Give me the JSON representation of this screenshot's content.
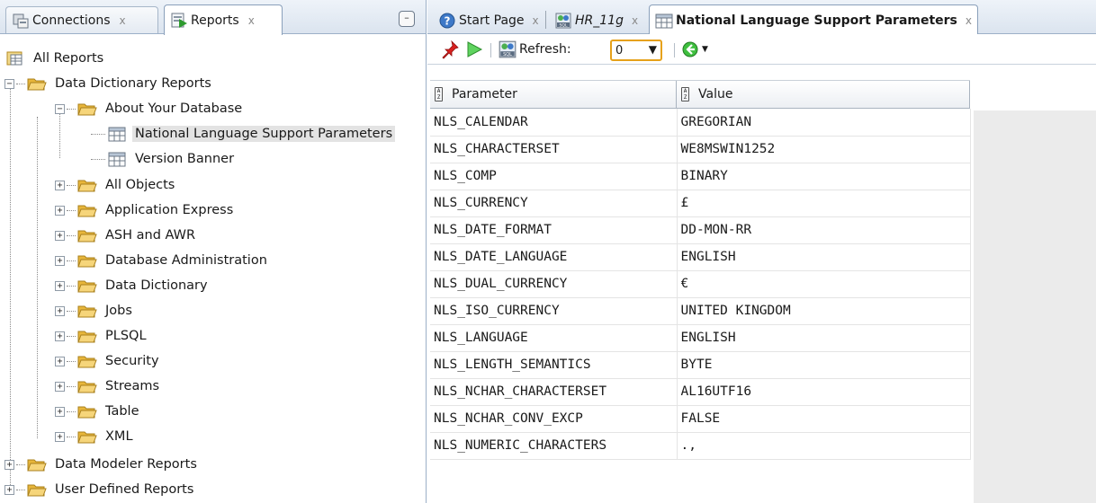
{
  "left_panel": {
    "tabs": [
      {
        "label": "Connections",
        "close": "x"
      },
      {
        "label": "Reports",
        "close": "x"
      }
    ],
    "minimize_label": "–",
    "tree": {
      "root": "All Reports",
      "data_dictionary_reports": "Data Dictionary Reports",
      "about_your_database": "About Your Database",
      "nls_parameters": "National Language Support Parameters",
      "version_banner": "Version Banner",
      "children": [
        "All Objects",
        "Application Express",
        "ASH and AWR",
        "Database Administration",
        "Data Dictionary",
        "Jobs",
        "PLSQL",
        "Security",
        "Streams",
        "Table",
        "XML"
      ],
      "data_modeler_reports": "Data Modeler Reports",
      "user_defined_reports": "User Defined Reports"
    }
  },
  "editor": {
    "tabs": [
      {
        "label": "Start Page",
        "close": "x"
      },
      {
        "label": "HR_11g",
        "close": "x"
      },
      {
        "label": "National Language Support Parameters",
        "close": "x"
      }
    ],
    "toolbar": {
      "refresh_label": "Refresh:",
      "refresh_value": "0"
    },
    "grid": {
      "columns": [
        "Parameter",
        "Value"
      ],
      "rows": [
        [
          "NLS_CALENDAR",
          "GREGORIAN"
        ],
        [
          "NLS_CHARACTERSET",
          "WE8MSWIN1252"
        ],
        [
          "NLS_COMP",
          "BINARY"
        ],
        [
          "NLS_CURRENCY",
          "£"
        ],
        [
          "NLS_DATE_FORMAT",
          "DD-MON-RR"
        ],
        [
          "NLS_DATE_LANGUAGE",
          "ENGLISH"
        ],
        [
          "NLS_DUAL_CURRENCY",
          "€"
        ],
        [
          "NLS_ISO_CURRENCY",
          "UNITED KINGDOM"
        ],
        [
          "NLS_LANGUAGE",
          "ENGLISH"
        ],
        [
          "NLS_LENGTH_SEMANTICS",
          "BYTE"
        ],
        [
          "NLS_NCHAR_CHARACTERSET",
          "AL16UTF16"
        ],
        [
          "NLS_NCHAR_CONV_EXCP",
          "FALSE"
        ],
        [
          "NLS_NUMERIC_CHARACTERS",
          ".,"
        ]
      ]
    }
  },
  "colors": {
    "tab_bg": "#dbe4ef",
    "selection": "#e3e3e3",
    "combo_border": "#e6a11a",
    "folder": "#e8b63a"
  }
}
